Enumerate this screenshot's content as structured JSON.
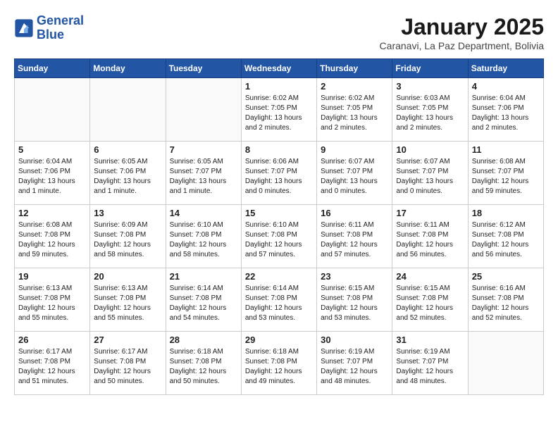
{
  "header": {
    "logo_line1": "General",
    "logo_line2": "Blue",
    "month": "January 2025",
    "location": "Caranavi, La Paz Department, Bolivia"
  },
  "weekdays": [
    "Sunday",
    "Monday",
    "Tuesday",
    "Wednesday",
    "Thursday",
    "Friday",
    "Saturday"
  ],
  "weeks": [
    [
      {
        "day": "",
        "info": ""
      },
      {
        "day": "",
        "info": ""
      },
      {
        "day": "",
        "info": ""
      },
      {
        "day": "1",
        "info": "Sunrise: 6:02 AM\nSunset: 7:05 PM\nDaylight: 13 hours and 2 minutes."
      },
      {
        "day": "2",
        "info": "Sunrise: 6:02 AM\nSunset: 7:05 PM\nDaylight: 13 hours and 2 minutes."
      },
      {
        "day": "3",
        "info": "Sunrise: 6:03 AM\nSunset: 7:05 PM\nDaylight: 13 hours and 2 minutes."
      },
      {
        "day": "4",
        "info": "Sunrise: 6:04 AM\nSunset: 7:06 PM\nDaylight: 13 hours and 2 minutes."
      }
    ],
    [
      {
        "day": "5",
        "info": "Sunrise: 6:04 AM\nSunset: 7:06 PM\nDaylight: 13 hours and 1 minute."
      },
      {
        "day": "6",
        "info": "Sunrise: 6:05 AM\nSunset: 7:06 PM\nDaylight: 13 hours and 1 minute."
      },
      {
        "day": "7",
        "info": "Sunrise: 6:05 AM\nSunset: 7:07 PM\nDaylight: 13 hours and 1 minute."
      },
      {
        "day": "8",
        "info": "Sunrise: 6:06 AM\nSunset: 7:07 PM\nDaylight: 13 hours and 0 minutes."
      },
      {
        "day": "9",
        "info": "Sunrise: 6:07 AM\nSunset: 7:07 PM\nDaylight: 13 hours and 0 minutes."
      },
      {
        "day": "10",
        "info": "Sunrise: 6:07 AM\nSunset: 7:07 PM\nDaylight: 13 hours and 0 minutes."
      },
      {
        "day": "11",
        "info": "Sunrise: 6:08 AM\nSunset: 7:07 PM\nDaylight: 12 hours and 59 minutes."
      }
    ],
    [
      {
        "day": "12",
        "info": "Sunrise: 6:08 AM\nSunset: 7:08 PM\nDaylight: 12 hours and 59 minutes."
      },
      {
        "day": "13",
        "info": "Sunrise: 6:09 AM\nSunset: 7:08 PM\nDaylight: 12 hours and 58 minutes."
      },
      {
        "day": "14",
        "info": "Sunrise: 6:10 AM\nSunset: 7:08 PM\nDaylight: 12 hours and 58 minutes."
      },
      {
        "day": "15",
        "info": "Sunrise: 6:10 AM\nSunset: 7:08 PM\nDaylight: 12 hours and 57 minutes."
      },
      {
        "day": "16",
        "info": "Sunrise: 6:11 AM\nSunset: 7:08 PM\nDaylight: 12 hours and 57 minutes."
      },
      {
        "day": "17",
        "info": "Sunrise: 6:11 AM\nSunset: 7:08 PM\nDaylight: 12 hours and 56 minutes."
      },
      {
        "day": "18",
        "info": "Sunrise: 6:12 AM\nSunset: 7:08 PM\nDaylight: 12 hours and 56 minutes."
      }
    ],
    [
      {
        "day": "19",
        "info": "Sunrise: 6:13 AM\nSunset: 7:08 PM\nDaylight: 12 hours and 55 minutes."
      },
      {
        "day": "20",
        "info": "Sunrise: 6:13 AM\nSunset: 7:08 PM\nDaylight: 12 hours and 55 minutes."
      },
      {
        "day": "21",
        "info": "Sunrise: 6:14 AM\nSunset: 7:08 PM\nDaylight: 12 hours and 54 minutes."
      },
      {
        "day": "22",
        "info": "Sunrise: 6:14 AM\nSunset: 7:08 PM\nDaylight: 12 hours and 53 minutes."
      },
      {
        "day": "23",
        "info": "Sunrise: 6:15 AM\nSunset: 7:08 PM\nDaylight: 12 hours and 53 minutes."
      },
      {
        "day": "24",
        "info": "Sunrise: 6:15 AM\nSunset: 7:08 PM\nDaylight: 12 hours and 52 minutes."
      },
      {
        "day": "25",
        "info": "Sunrise: 6:16 AM\nSunset: 7:08 PM\nDaylight: 12 hours and 52 minutes."
      }
    ],
    [
      {
        "day": "26",
        "info": "Sunrise: 6:17 AM\nSunset: 7:08 PM\nDaylight: 12 hours and 51 minutes."
      },
      {
        "day": "27",
        "info": "Sunrise: 6:17 AM\nSunset: 7:08 PM\nDaylight: 12 hours and 50 minutes."
      },
      {
        "day": "28",
        "info": "Sunrise: 6:18 AM\nSunset: 7:08 PM\nDaylight: 12 hours and 50 minutes."
      },
      {
        "day": "29",
        "info": "Sunrise: 6:18 AM\nSunset: 7:08 PM\nDaylight: 12 hours and 49 minutes."
      },
      {
        "day": "30",
        "info": "Sunrise: 6:19 AM\nSunset: 7:07 PM\nDaylight: 12 hours and 48 minutes."
      },
      {
        "day": "31",
        "info": "Sunrise: 6:19 AM\nSunset: 7:07 PM\nDaylight: 12 hours and 48 minutes."
      },
      {
        "day": "",
        "info": ""
      }
    ]
  ]
}
